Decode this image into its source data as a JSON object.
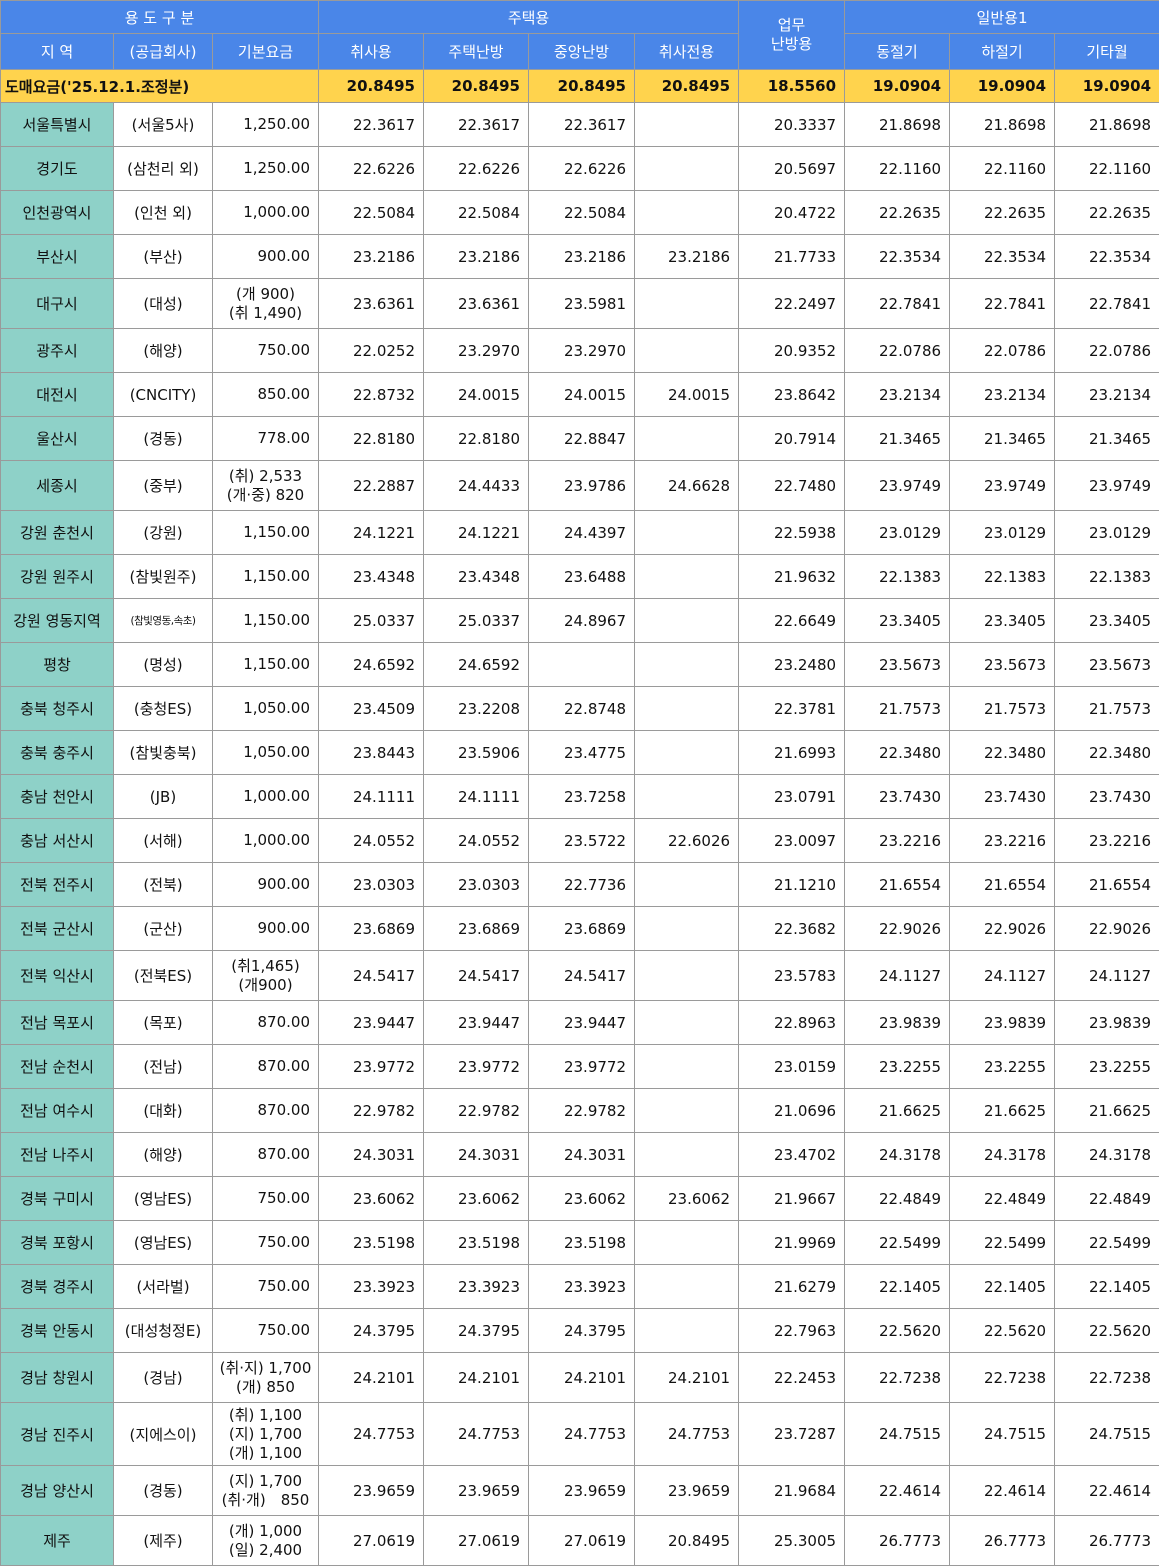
{
  "header": {
    "usage": "용 도 구 분",
    "housing": "주택용",
    "business": "업무\n난방용",
    "general": "일반용1",
    "region": "지 역",
    "company": "(공급회사)",
    "base": "기본요금",
    "cooking": "취사용",
    "house_heat": "주택난방",
    "central_heat": "중앙난방",
    "cooking_only": "취사전용",
    "winter": "동절기",
    "summer": "하절기",
    "other_month": "기타월"
  },
  "wholesale": {
    "label": "도매요금('25.12.1.조정분)",
    "values": [
      "20.8495",
      "20.8495",
      "20.8495",
      "20.8495",
      "18.5560",
      "19.0904",
      "19.0904",
      "19.0904"
    ]
  },
  "rows": [
    {
      "region": "서울특별시",
      "company": "(서울5사)",
      "base": [
        "1,250.00"
      ],
      "values": [
        "22.3617",
        "22.3617",
        "22.3617",
        "",
        "20.3337",
        "21.8698",
        "21.8698",
        "21.8698"
      ]
    },
    {
      "region": "경기도",
      "company": "(삼천리 외)",
      "base": [
        "1,250.00"
      ],
      "values": [
        "22.6226",
        "22.6226",
        "22.6226",
        "",
        "20.5697",
        "22.1160",
        "22.1160",
        "22.1160"
      ]
    },
    {
      "region": "인천광역시",
      "company": "(인천 외)",
      "base": [
        "1,000.00"
      ],
      "values": [
        "22.5084",
        "22.5084",
        "22.5084",
        "",
        "20.4722",
        "22.2635",
        "22.2635",
        "22.2635"
      ]
    },
    {
      "region": "부산시",
      "company": "(부산)",
      "base": [
        "900.00"
      ],
      "values": [
        "23.2186",
        "23.2186",
        "23.2186",
        "23.2186",
        "21.7733",
        "22.3534",
        "22.3534",
        "22.3534"
      ]
    },
    {
      "region": "대구시",
      "company": "(대성)",
      "base": [
        "(개 900)",
        "(취 1,490)"
      ],
      "values": [
        "23.6361",
        "23.6361",
        "23.5981",
        "",
        "22.2497",
        "22.7841",
        "22.7841",
        "22.7841"
      ]
    },
    {
      "region": "광주시",
      "company": "(해양)",
      "base": [
        "750.00"
      ],
      "values": [
        "22.0252",
        "23.2970",
        "23.2970",
        "",
        "20.9352",
        "22.0786",
        "22.0786",
        "22.0786"
      ]
    },
    {
      "region": "대전시",
      "company": "(CNCITY)",
      "base": [
        "850.00"
      ],
      "values": [
        "22.8732",
        "24.0015",
        "24.0015",
        "24.0015",
        "23.8642",
        "23.2134",
        "23.2134",
        "23.2134"
      ]
    },
    {
      "region": "울산시",
      "company": "(경동)",
      "base": [
        "778.00"
      ],
      "values": [
        "22.8180",
        "22.8180",
        "22.8847",
        "",
        "20.7914",
        "21.3465",
        "21.3465",
        "21.3465"
      ]
    },
    {
      "region": "세종시",
      "company": "(중부)",
      "base": [
        "(취) 2,533",
        "(개·중) 820"
      ],
      "values": [
        "22.2887",
        "24.4433",
        "23.9786",
        "24.6628",
        "22.7480",
        "23.9749",
        "23.9749",
        "23.9749"
      ]
    },
    {
      "region": "강원 춘천시",
      "company": "(강원)",
      "base": [
        "1,150.00"
      ],
      "values": [
        "24.1221",
        "24.1221",
        "24.4397",
        "",
        "22.5938",
        "23.0129",
        "23.0129",
        "23.0129"
      ]
    },
    {
      "region": "강원 원주시",
      "company": "(참빛원주)",
      "base": [
        "1,150.00"
      ],
      "values": [
        "23.4348",
        "23.4348",
        "23.6488",
        "",
        "21.9632",
        "22.1383",
        "22.1383",
        "22.1383"
      ]
    },
    {
      "region": "강원 영동지역",
      "company": "(참빛영동,속초)",
      "small": true,
      "base": [
        "1,150.00"
      ],
      "values": [
        "25.0337",
        "25.0337",
        "24.8967",
        "",
        "22.6649",
        "23.3405",
        "23.3405",
        "23.3405"
      ]
    },
    {
      "region": "평창",
      "company": "(명성)",
      "base": [
        "1,150.00"
      ],
      "values": [
        "24.6592",
        "24.6592",
        "",
        "",
        "23.2480",
        "23.5673",
        "23.5673",
        "23.5673"
      ]
    },
    {
      "region": "충북 청주시",
      "company": "(충청ES)",
      "base": [
        "1,050.00"
      ],
      "values": [
        "23.4509",
        "23.2208",
        "22.8748",
        "",
        "22.3781",
        "21.7573",
        "21.7573",
        "21.7573"
      ]
    },
    {
      "region": "충북 충주시",
      "company": "(참빛충북)",
      "base": [
        "1,050.00"
      ],
      "values": [
        "23.8443",
        "23.5906",
        "23.4775",
        "",
        "21.6993",
        "22.3480",
        "22.3480",
        "22.3480"
      ]
    },
    {
      "region": "충남 천안시",
      "company": "(JB)",
      "base": [
        "1,000.00"
      ],
      "values": [
        "24.1111",
        "24.1111",
        "23.7258",
        "",
        "23.0791",
        "23.7430",
        "23.7430",
        "23.7430"
      ]
    },
    {
      "region": "충남 서산시",
      "company": "(서해)",
      "base": [
        "1,000.00"
      ],
      "values": [
        "24.0552",
        "24.0552",
        "23.5722",
        "22.6026",
        "23.0097",
        "23.2216",
        "23.2216",
        "23.2216"
      ]
    },
    {
      "region": "전북 전주시",
      "company": "(전북)",
      "base": [
        "900.00"
      ],
      "values": [
        "23.0303",
        "23.0303",
        "22.7736",
        "",
        "21.1210",
        "21.6554",
        "21.6554",
        "21.6554"
      ]
    },
    {
      "region": "전북 군산시",
      "company": "(군산)",
      "base": [
        "900.00"
      ],
      "values": [
        "23.6869",
        "23.6869",
        "23.6869",
        "",
        "22.3682",
        "22.9026",
        "22.9026",
        "22.9026"
      ]
    },
    {
      "region": "전북 익산시",
      "company": "(전북ES)",
      "base": [
        "(취1,465)",
        "(개900)"
      ],
      "values": [
        "24.5417",
        "24.5417",
        "24.5417",
        "",
        "23.5783",
        "24.1127",
        "24.1127",
        "24.1127"
      ]
    },
    {
      "region": "전남 목포시",
      "company": "(목포)",
      "base": [
        "870.00"
      ],
      "values": [
        "23.9447",
        "23.9447",
        "23.9447",
        "",
        "22.8963",
        "23.9839",
        "23.9839",
        "23.9839"
      ]
    },
    {
      "region": "전남 순천시",
      "company": "(전남)",
      "base": [
        "870.00"
      ],
      "values": [
        "23.9772",
        "23.9772",
        "23.9772",
        "",
        "23.0159",
        "23.2255",
        "23.2255",
        "23.2255"
      ]
    },
    {
      "region": "전남 여수시",
      "company": "(대화)",
      "base": [
        "870.00"
      ],
      "values": [
        "22.9782",
        "22.9782",
        "22.9782",
        "",
        "21.0696",
        "21.6625",
        "21.6625",
        "21.6625"
      ]
    },
    {
      "region": "전남 나주시",
      "company": "(해양)",
      "base": [
        "870.00"
      ],
      "values": [
        "24.3031",
        "24.3031",
        "24.3031",
        "",
        "23.4702",
        "24.3178",
        "24.3178",
        "24.3178"
      ]
    },
    {
      "region": "경북 구미시",
      "company": "(영남ES)",
      "base": [
        "750.00"
      ],
      "values": [
        "23.6062",
        "23.6062",
        "23.6062",
        "23.6062",
        "21.9667",
        "22.4849",
        "22.4849",
        "22.4849"
      ]
    },
    {
      "region": "경북 포항시",
      "company": "(영남ES)",
      "base": [
        "750.00"
      ],
      "values": [
        "23.5198",
        "23.5198",
        "23.5198",
        "",
        "21.9969",
        "22.5499",
        "22.5499",
        "22.5499"
      ]
    },
    {
      "region": "경북 경주시",
      "company": "(서라벌)",
      "base": [
        "750.00"
      ],
      "values": [
        "23.3923",
        "23.3923",
        "23.3923",
        "",
        "21.6279",
        "22.1405",
        "22.1405",
        "22.1405"
      ]
    },
    {
      "region": "경북 안동시",
      "company": "(대성청정E)",
      "base": [
        "750.00"
      ],
      "values": [
        "24.3795",
        "24.3795",
        "24.3795",
        "",
        "22.7963",
        "22.5620",
        "22.5620",
        "22.5620"
      ]
    },
    {
      "region": "경남 창원시",
      "company": "(경남)",
      "base": [
        "(취·지) 1,700",
        "(개) 850"
      ],
      "values": [
        "24.2101",
        "24.2101",
        "24.2101",
        "24.2101",
        "22.2453",
        "22.7238",
        "22.7238",
        "22.7238"
      ]
    },
    {
      "region": "경남 진주시",
      "company": "(지에스이)",
      "base": [
        "(취) 1,100",
        "(지) 1,700",
        "(개) 1,100"
      ],
      "values": [
        "24.7753",
        "24.7753",
        "24.7753",
        "24.7753",
        "23.7287",
        "24.7515",
        "24.7515",
        "24.7515"
      ]
    },
    {
      "region": "경남 양산시",
      "company": "(경동)",
      "base": [
        "(지) 1,700",
        "(취·개)　850"
      ],
      "values": [
        "23.9659",
        "23.9659",
        "23.9659",
        "23.9659",
        "21.9684",
        "22.4614",
        "22.4614",
        "22.4614"
      ]
    },
    {
      "region": "제주",
      "company": "(제주)",
      "base": [
        "(개) 1,000",
        "(일) 2,400"
      ],
      "values": [
        "27.0619",
        "27.0619",
        "27.0619",
        "20.8495",
        "25.3005",
        "26.7773",
        "26.7773",
        "26.7773"
      ]
    }
  ]
}
